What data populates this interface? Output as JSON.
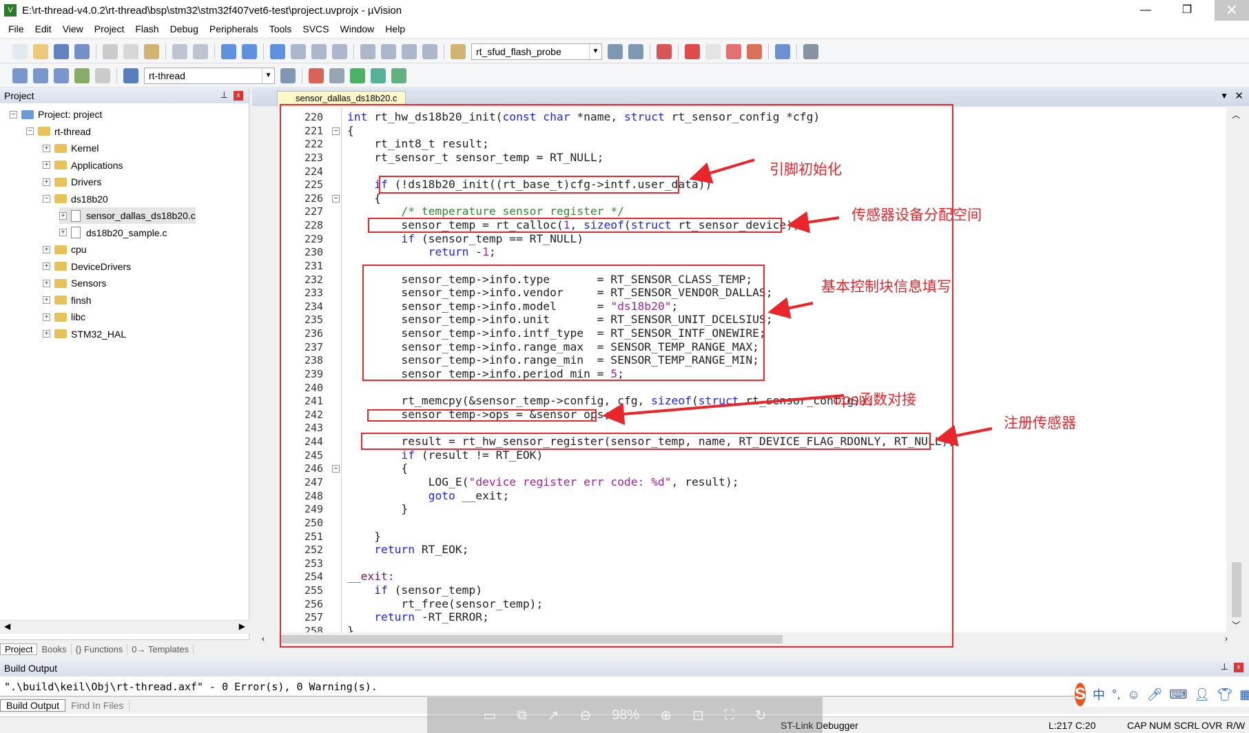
{
  "window": {
    "title": "E:\\rt-thread-v4.0.2\\rt-thread\\bsp\\stm32\\stm32f407vet6-test\\project.uvprojx - µVision",
    "minimize": "—",
    "restore": "❐",
    "close": "✕"
  },
  "menu": [
    "File",
    "Edit",
    "View",
    "Project",
    "Flash",
    "Debug",
    "Peripherals",
    "Tools",
    "SVCS",
    "Window",
    "Help"
  ],
  "toolbar1": {
    "combo": "rt_sfud_flash_probe"
  },
  "toolbar2": {
    "target": "rt-thread"
  },
  "project_panel": {
    "title": "Project",
    "pin": "📌",
    "close": "x",
    "tree": [
      {
        "label": "Project: project",
        "level": 0,
        "kind": "root",
        "exp": "−"
      },
      {
        "label": "rt-thread",
        "level": 1,
        "kind": "folder",
        "exp": "−"
      },
      {
        "label": "Kernel",
        "level": 2,
        "kind": "folder",
        "exp": "+"
      },
      {
        "label": "Applications",
        "level": 2,
        "kind": "folder",
        "exp": "+"
      },
      {
        "label": "Drivers",
        "level": 2,
        "kind": "folder",
        "exp": "+"
      },
      {
        "label": "ds18b20",
        "level": 2,
        "kind": "folder",
        "exp": "−"
      },
      {
        "label": "sensor_dallas_ds18b20.c",
        "level": 3,
        "kind": "file",
        "exp": "+",
        "selected": true
      },
      {
        "label": "ds18b20_sample.c",
        "level": 3,
        "kind": "file",
        "exp": "+"
      },
      {
        "label": "cpu",
        "level": 2,
        "kind": "folder",
        "exp": "+"
      },
      {
        "label": "DeviceDrivers",
        "level": 2,
        "kind": "folder",
        "exp": "+"
      },
      {
        "label": "Sensors",
        "level": 2,
        "kind": "folder",
        "exp": "+"
      },
      {
        "label": "finsh",
        "level": 2,
        "kind": "folder",
        "exp": "+"
      },
      {
        "label": "libc",
        "level": 2,
        "kind": "folder",
        "exp": "+"
      },
      {
        "label": "STM32_HAL",
        "level": 2,
        "kind": "folder",
        "exp": "+"
      }
    ],
    "tabs": [
      "Project",
      "Books",
      "{} Functions",
      "0→ Templates"
    ]
  },
  "editor": {
    "tab": "sensor_dallas_ds18b20.c",
    "first_line": 220,
    "fold_lines": [
      221,
      226,
      246
    ],
    "lines": [
      "int rt_hw_ds18b20_init(const char *name, struct rt_sensor_config *cfg)",
      "{",
      "    rt_int8_t result;",
      "    rt_sensor_t sensor_temp = RT_NULL;",
      "",
      "    if (!ds18b20_init((rt_base_t)cfg->intf.user_data))",
      "    {",
      "        /* temperature sensor register */",
      "        sensor_temp = rt_calloc(1, sizeof(struct rt_sensor_device));",
      "        if (sensor_temp == RT_NULL)",
      "            return -1;",
      "",
      "        sensor_temp->info.type       = RT_SENSOR_CLASS_TEMP;",
      "        sensor_temp->info.vendor     = RT_SENSOR_VENDOR_DALLAS;",
      "        sensor_temp->info.model      = \"ds18b20\";",
      "        sensor_temp->info.unit       = RT_SENSOR_UNIT_DCELSIUS;",
      "        sensor_temp->info.intf_type  = RT_SENSOR_INTF_ONEWIRE;",
      "        sensor_temp->info.range_max  = SENSOR_TEMP_RANGE_MAX;",
      "        sensor_temp->info.range_min  = SENSOR_TEMP_RANGE_MIN;",
      "        sensor_temp->info.period_min = 5;",
      "",
      "        rt_memcpy(&sensor_temp->config, cfg, sizeof(struct rt_sensor_config));",
      "        sensor_temp->ops = &sensor_ops;",
      "",
      "        result = rt_hw_sensor_register(sensor_temp, name, RT_DEVICE_FLAG_RDONLY, RT_NULL);",
      "        if (result != RT_EOK)",
      "        {",
      "            LOG_E(\"device register err code: %d\", result);",
      "            goto __exit;",
      "        }",
      "",
      "    }",
      "    return RT_EOK;",
      "",
      "__exit:",
      "    if (sensor_temp)",
      "        rt_free(sensor_temp);",
      "    return -RT_ERROR;",
      "}"
    ]
  },
  "annotations": {
    "color": "#e8262b",
    "pin_init": "引脚初始化",
    "alloc": "传感器设备分配空间",
    "info_fill": "基本控制块信息填写",
    "ops": "ops函数对接",
    "register": "注册传感器"
  },
  "build_output": {
    "title": "Build Output",
    "text": "\".\\build\\keil\\Obj\\rt-thread.axf\" - 0 Error(s), 0 Warning(s).",
    "tabs": [
      "Build Output",
      "Find In Files"
    ]
  },
  "status": {
    "debugger": "ST-Link Debugger",
    "position": "L:217 C:20",
    "caps": "CAP",
    "num": "NUM",
    "scrl": "SCRL",
    "ovr": "OVR",
    "rw": "R/W"
  },
  "viewer_overlay": {
    "zoom": "98%"
  },
  "ime": {
    "logo": "S",
    "mode": "中",
    "punct": "°,"
  }
}
